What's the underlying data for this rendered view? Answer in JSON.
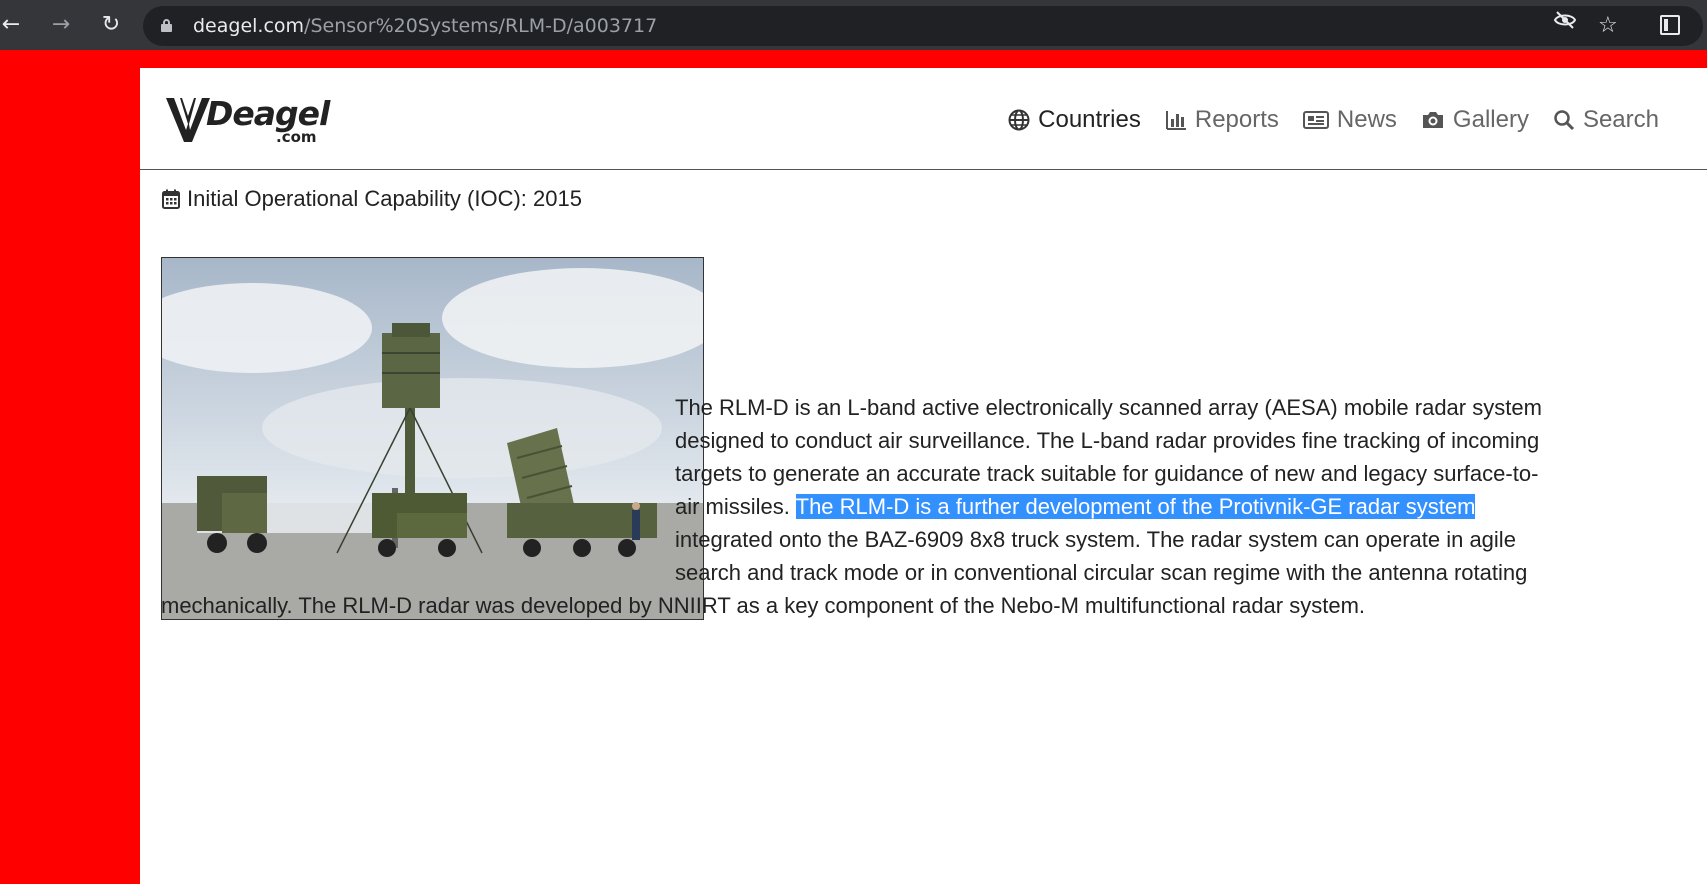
{
  "browser": {
    "url_host": "deagel.com",
    "url_path": "/Sensor%20Systems/RLM-D/a003717"
  },
  "site": {
    "logo_text": "Deagel",
    "logo_suffix": ".com",
    "nav": [
      {
        "label": "Countries",
        "icon": "globe-icon"
      },
      {
        "label": "Reports",
        "icon": "bar-chart-icon"
      },
      {
        "label": "News",
        "icon": "newspaper-icon"
      },
      {
        "label": "Gallery",
        "icon": "camera-icon"
      },
      {
        "label": "Search",
        "icon": "search-icon"
      }
    ]
  },
  "article": {
    "ioc": "Initial Operational Capability (IOC): 2015",
    "lines": [
      "The RLM-D is an L-band active electronically scanned array (AESA) mobile radar system",
      "designed to conduct air surveillance. The L-band radar provides fine tracking of incoming",
      "targets to generate an accurate track suitable for guidance of new and legacy surface-to-",
      "air missiles. ",
      "The RLM-D is a further development of the Protivnik-GE radar system",
      "integrated onto the BAZ-6909 8x8 truck system. The radar system can operate in agile",
      "search and track mode or in conventional circular scan regime with the antenna rotating",
      "mechanically. The RLM-D radar was developed by NNIIRT as a key component of the Nebo-M multifunctional radar system."
    ]
  },
  "colors": {
    "page_background": "#ff0000",
    "selection": "#3390ff"
  }
}
